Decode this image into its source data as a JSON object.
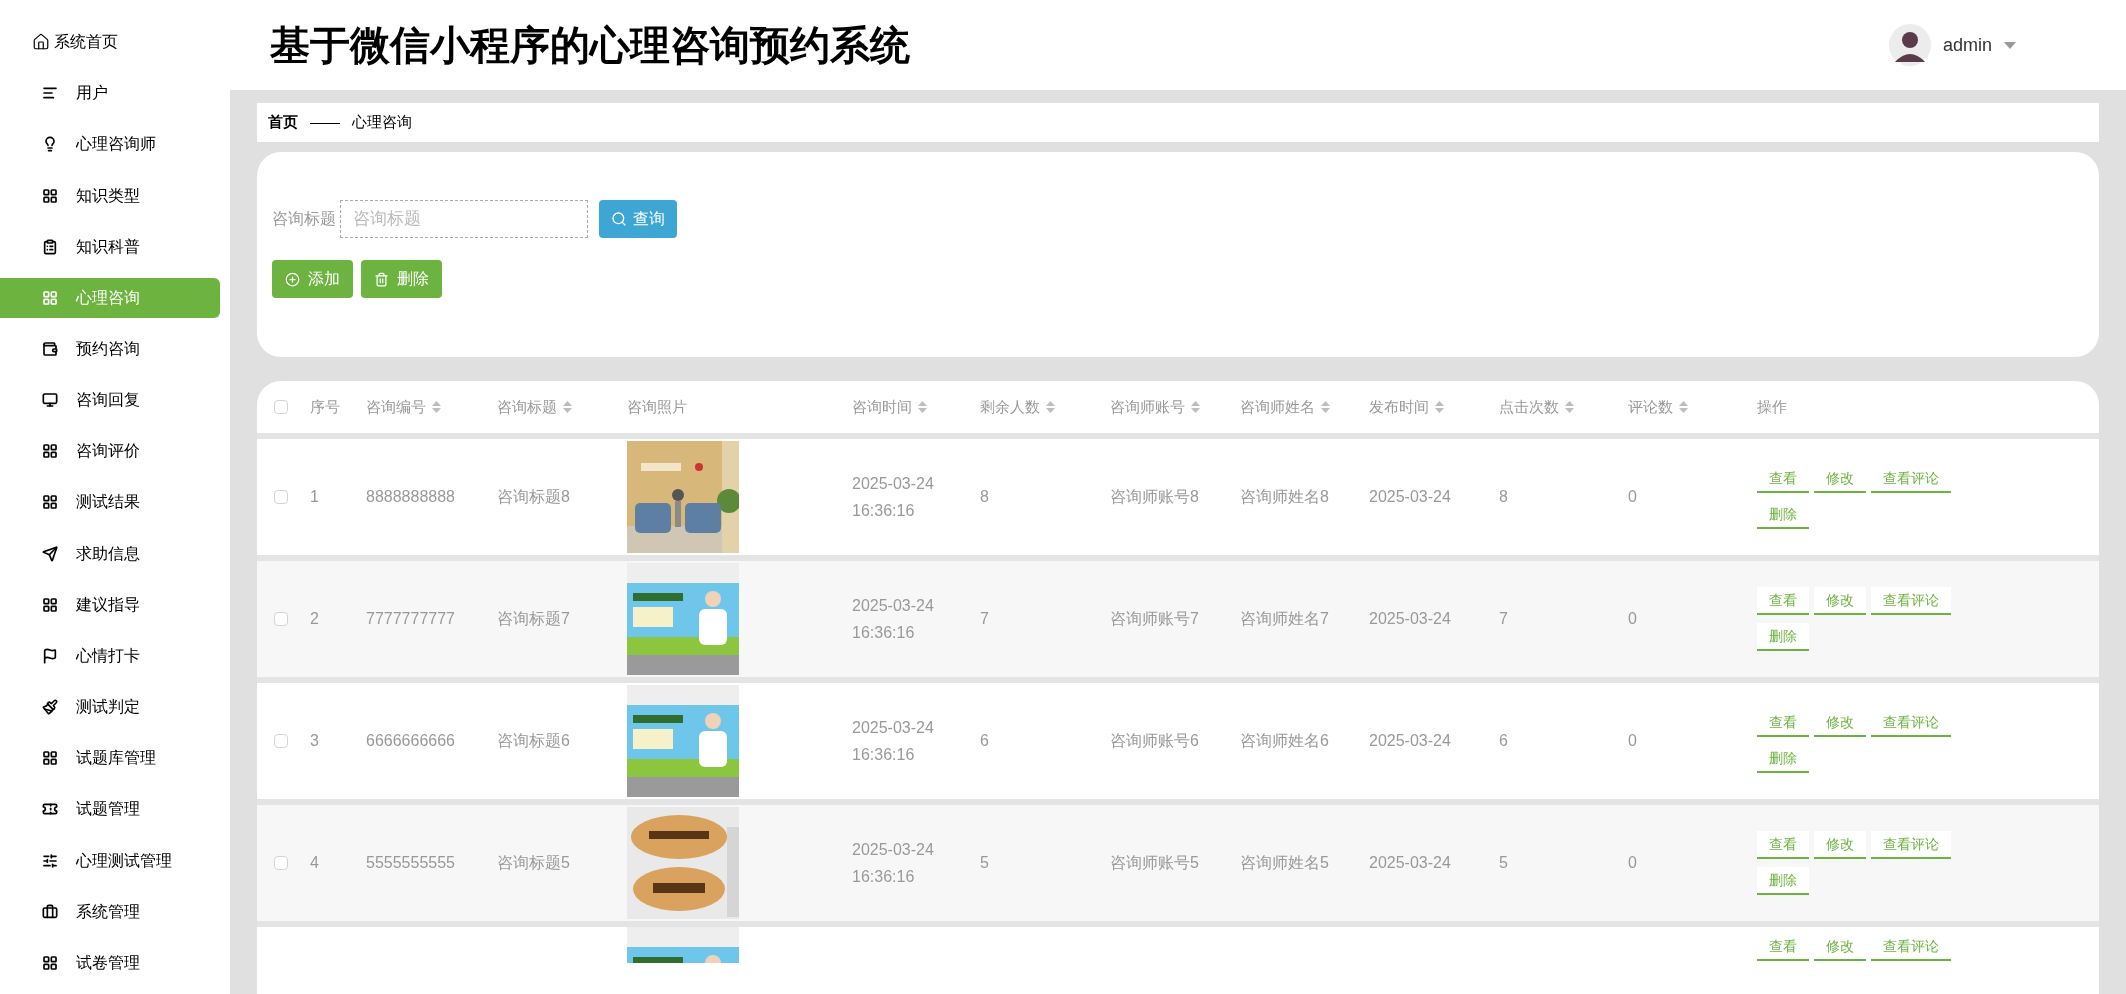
{
  "sidebar": {
    "items": [
      {
        "label": "系统首页",
        "selected": false
      },
      {
        "label": "用户",
        "selected": false
      },
      {
        "label": "心理咨询师",
        "selected": false
      },
      {
        "label": "知识类型",
        "selected": false
      },
      {
        "label": "知识科普",
        "selected": false
      },
      {
        "label": "心理咨询",
        "selected": true
      },
      {
        "label": "预约咨询",
        "selected": false
      },
      {
        "label": "咨询回复",
        "selected": false
      },
      {
        "label": "咨询评价",
        "selected": false
      },
      {
        "label": "测试结果",
        "selected": false
      },
      {
        "label": "求助信息",
        "selected": false
      },
      {
        "label": "建议指导",
        "selected": false
      },
      {
        "label": "心情打卡",
        "selected": false
      },
      {
        "label": "测试判定",
        "selected": false
      },
      {
        "label": "试题库管理",
        "selected": false
      },
      {
        "label": "试题管理",
        "selected": false
      },
      {
        "label": "心理测试管理",
        "selected": false
      },
      {
        "label": "系统管理",
        "selected": false
      },
      {
        "label": "试卷管理",
        "selected": false
      }
    ]
  },
  "header": {
    "title": "基于微信小程序的心理咨询预约系统",
    "user": "admin"
  },
  "breadcrumb": [
    "首页",
    "——",
    "心理咨询"
  ],
  "search": {
    "label": "咨询标题",
    "placeholder": "咨询标题",
    "button": "查询"
  },
  "actions": [
    "添加",
    "删除"
  ],
  "table": {
    "select_all": {
      "checked": false
    },
    "columns": [
      {
        "label": "序号",
        "sortable": false
      },
      {
        "label": "咨询编号",
        "sortable": true
      },
      {
        "label": "咨询标题",
        "sortable": true
      },
      {
        "label": "咨询照片",
        "sortable": false
      },
      {
        "label": "咨询时间",
        "sortable": true
      },
      {
        "label": "剩余人数",
        "sortable": true
      },
      {
        "label": "咨询师账号",
        "sortable": true
      },
      {
        "label": "咨询师姓名",
        "sortable": true
      },
      {
        "label": "发布时间",
        "sortable": true
      },
      {
        "label": "点击次数",
        "sortable": true
      },
      {
        "label": "评论数",
        "sortable": true
      },
      {
        "label": "操作",
        "sortable": false
      }
    ],
    "rows": [
      {
        "checked": false,
        "cells": [
          "1",
          "8888888888",
          "咨询标题8"
        ],
        "photo": {
          "kind": "picture"
        },
        "time": [
          "2025-03-24",
          "16:36:16"
        ],
        "rest": [
          "8",
          "咨询师账号8",
          "咨询师姓名8",
          "2025-03-24",
          "8",
          "0"
        ],
        "buttons": [
          "查看",
          "修改",
          "查看评论",
          "删除"
        ]
      },
      {
        "checked": false,
        "cells": [
          "2",
          "7777777777",
          "咨询标题7"
        ],
        "photo": {
          "kind": "picture"
        },
        "time": [
          "2025-03-24",
          "16:36:16"
        ],
        "rest": [
          "7",
          "咨询师账号7",
          "咨询师姓名7",
          "2025-03-24",
          "7",
          "0"
        ],
        "buttons": [
          "查看",
          "修改",
          "查看评论",
          "删除"
        ]
      },
      {
        "checked": false,
        "cells": [
          "3",
          "6666666666",
          "咨询标题6"
        ],
        "photo": {
          "kind": "picture"
        },
        "time": [
          "2025-03-24",
          "16:36:16"
        ],
        "rest": [
          "6",
          "咨询师账号6",
          "咨询师姓名6",
          "2025-03-24",
          "6",
          "0"
        ],
        "buttons": [
          "查看",
          "修改",
          "查看评论",
          "删除"
        ]
      },
      {
        "checked": false,
        "cells": [
          "4",
          "5555555555",
          "咨询标题5"
        ],
        "photo": {
          "kind": "picture"
        },
        "time": [
          "2025-03-24",
          "16:36:16"
        ],
        "rest": [
          "5",
          "咨询师账号5",
          "咨询师姓名5",
          "2025-03-24",
          "5",
          "0"
        ],
        "buttons": [
          "查看",
          "修改",
          "查看评论",
          "删除"
        ]
      }
    ],
    "partial_row": {
      "photo": {
        "kind": "picture"
      },
      "buttons": [
        "查看",
        "修改",
        "查看评论"
      ]
    }
  }
}
